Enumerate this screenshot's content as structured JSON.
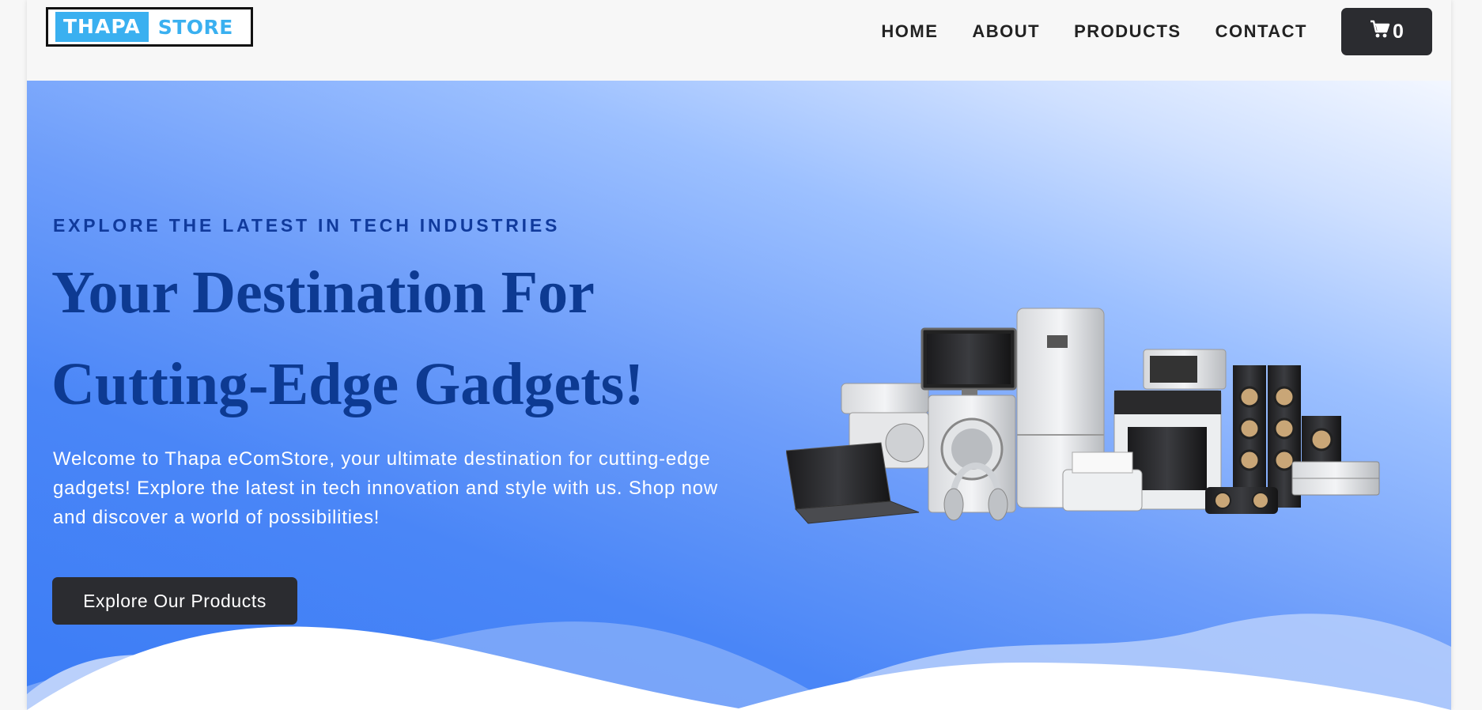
{
  "header": {
    "logo": {
      "part1": "THAPA",
      "part2": "STORE"
    },
    "nav": [
      {
        "label": "HOME"
      },
      {
        "label": "ABOUT"
      },
      {
        "label": "PRODUCTS"
      },
      {
        "label": "CONTACT"
      }
    ],
    "cart": {
      "count": "0",
      "icon": "cart-icon"
    }
  },
  "hero": {
    "tagline": "EXPLORE THE LATEST IN TECH INDUSTRIES",
    "headline_line1": "Your Destination For",
    "headline_line2": "Cutting-Edge Gadgets!",
    "description": "Welcome to Thapa eComStore, your ultimate destination for cutting-edge gadgets! Explore the latest in tech innovation and style with us. Shop now and discover a world of possibilities!",
    "cta_label": "Explore Our Products"
  },
  "colors": {
    "accent_blue": "#3ab0f0",
    "headline": "#0d3a92",
    "button_dark": "#2b2c30",
    "hero_blue": "#3b7cf6"
  }
}
